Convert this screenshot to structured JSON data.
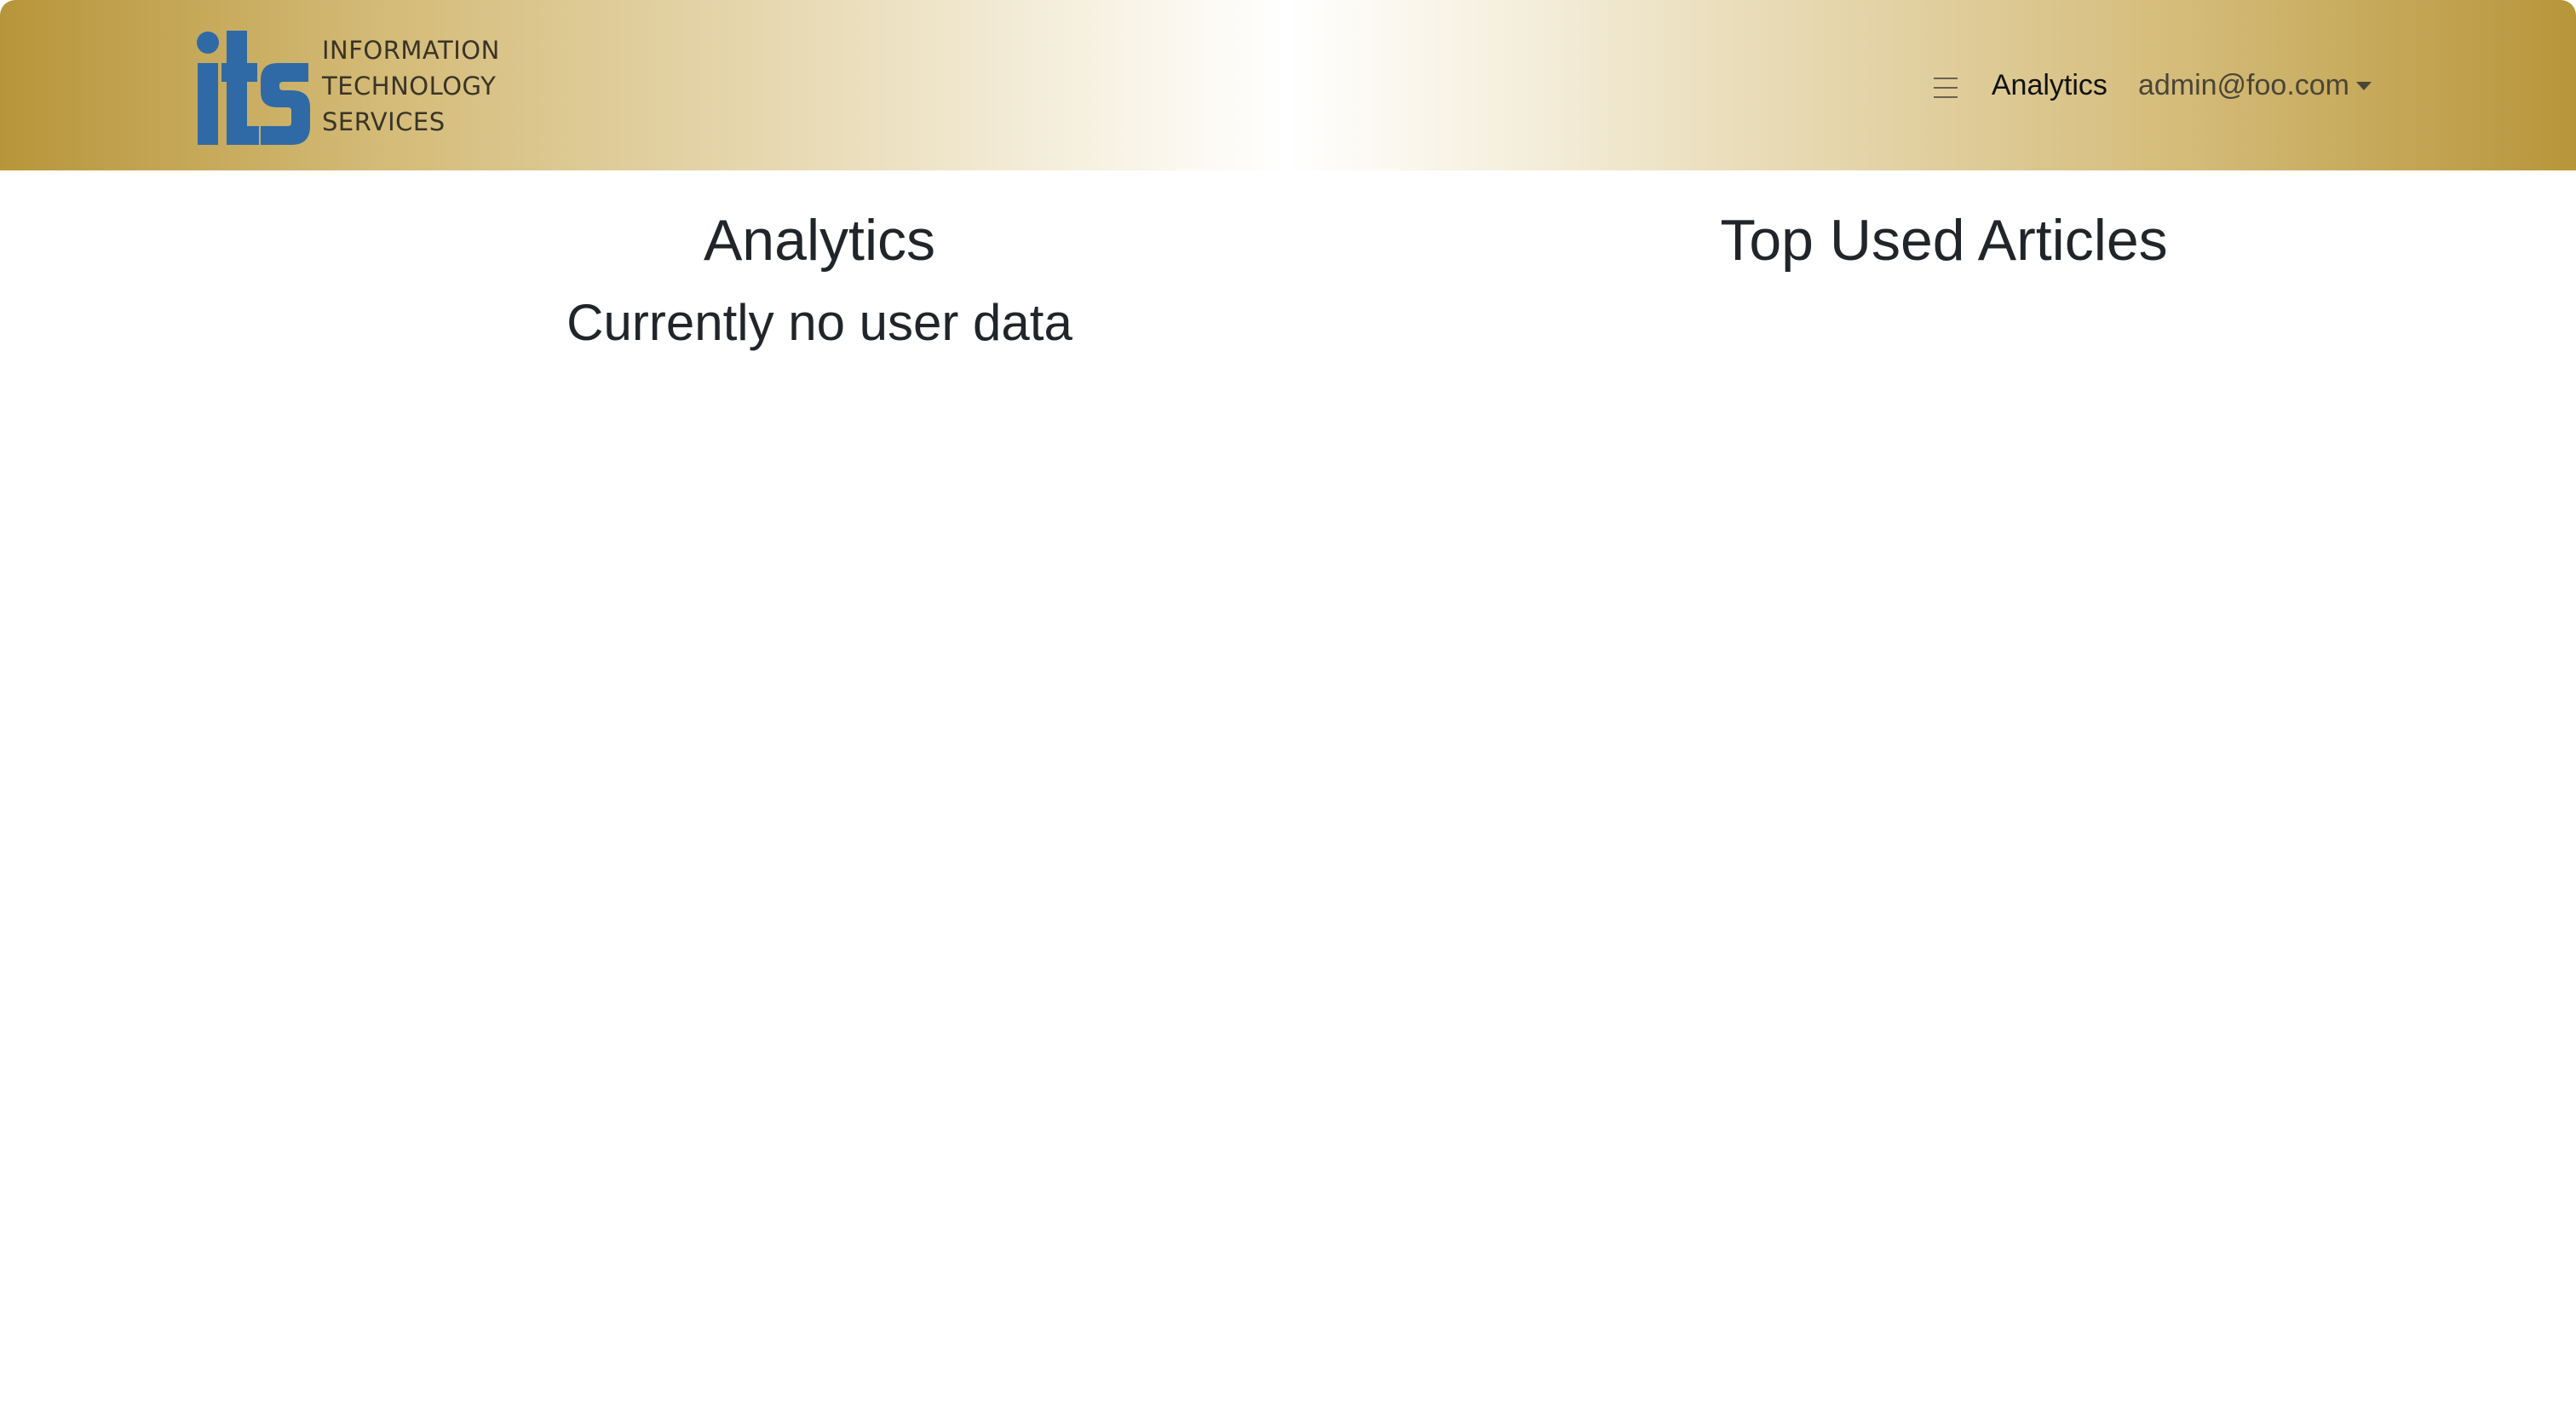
{
  "header": {
    "logo_letters": "its",
    "brand_lines": [
      "INFORMATION",
      "TECHNOLOGY",
      "SERVICES"
    ],
    "menu_icon": "hamburger-menu-icon",
    "nav_link": "Analytics",
    "user_email": "admin@foo.com",
    "colors": {
      "gradient_edge": "#b7953a",
      "gradient_center": "#ffffff",
      "logo_blue": "#2f6aa6"
    }
  },
  "main": {
    "analytics_title": "Analytics",
    "analytics_status": "Currently no user data",
    "articles_title": "Top Used Articles"
  }
}
